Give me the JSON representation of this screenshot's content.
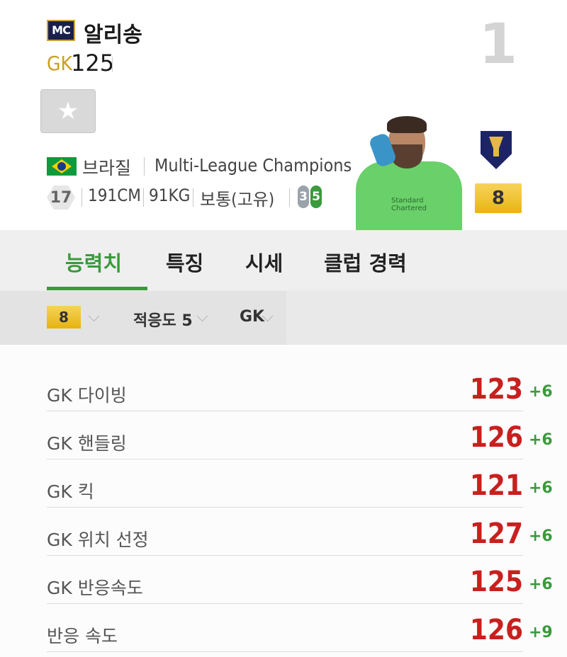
{
  "player": {
    "card_badge": "MC",
    "name": "알리송",
    "position": "GK",
    "overall": "125",
    "rank": "1",
    "nation": "브라질",
    "league": "Multi-League Champions",
    "age": "17",
    "height": "191CM",
    "weight": "91KG",
    "body_type": "보통(고유)",
    "weak_foot": "3",
    "skill_moves": "5",
    "enhance_grade": "8",
    "shirt_sponsor": "Standard Chartered"
  },
  "favorite_button": {
    "icon": "star-icon"
  },
  "tabs": [
    {
      "label": "능력치",
      "active": true
    },
    {
      "label": "특징",
      "active": false
    },
    {
      "label": "시세",
      "active": false
    },
    {
      "label": "클럽 경력",
      "active": false
    }
  ],
  "filters": {
    "grade": "8",
    "adaptability": "적응도 5",
    "position": "GK"
  },
  "stats": [
    {
      "name": "GK 다이빙",
      "value": "123",
      "bonus": "+6"
    },
    {
      "name": "GK 핸들링",
      "value": "126",
      "bonus": "+6"
    },
    {
      "name": "GK 킥",
      "value": "121",
      "bonus": "+6"
    },
    {
      "name": "GK 위치 선정",
      "value": "127",
      "bonus": "+6"
    },
    {
      "name": "GK 반응속도",
      "value": "125",
      "bonus": "+6"
    },
    {
      "name": "반응 속도",
      "value": "126",
      "bonus": "+9"
    }
  ],
  "colors": {
    "accent_green": "#3a9a3c",
    "stat_red": "#c8201e",
    "gold": "#c9a020"
  }
}
